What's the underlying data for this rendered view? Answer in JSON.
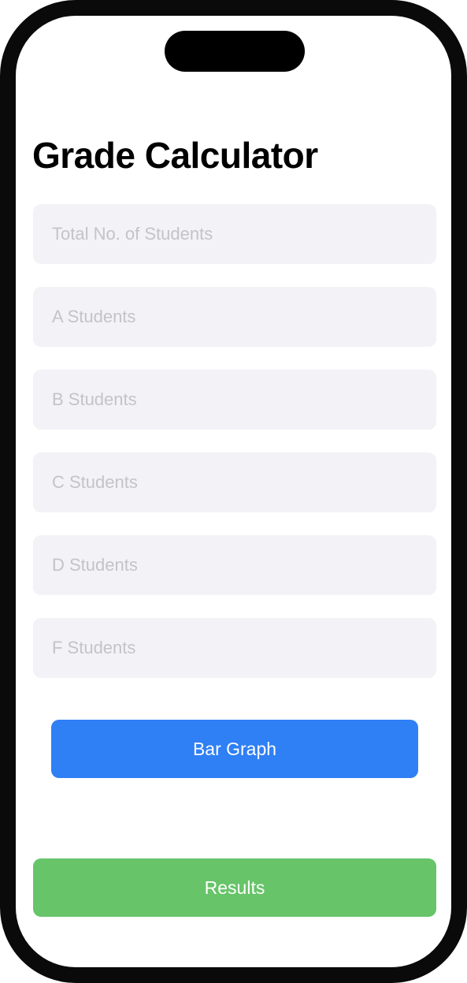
{
  "header": {
    "title": "Grade Calculator"
  },
  "form": {
    "fields": [
      {
        "placeholder": "Total No. of Students",
        "value": ""
      },
      {
        "placeholder": "A Students",
        "value": ""
      },
      {
        "placeholder": "B Students",
        "value": ""
      },
      {
        "placeholder": "C Students",
        "value": ""
      },
      {
        "placeholder": "D Students",
        "value": ""
      },
      {
        "placeholder": "F Students",
        "value": ""
      }
    ]
  },
  "actions": {
    "bar_graph_label": "Bar Graph",
    "results_label": "Results"
  },
  "colors": {
    "field_background": "#f2f2f7",
    "placeholder_text": "#c4c4c8",
    "bar_graph_button": "#2f7ff5",
    "results_button": "#67c469"
  }
}
